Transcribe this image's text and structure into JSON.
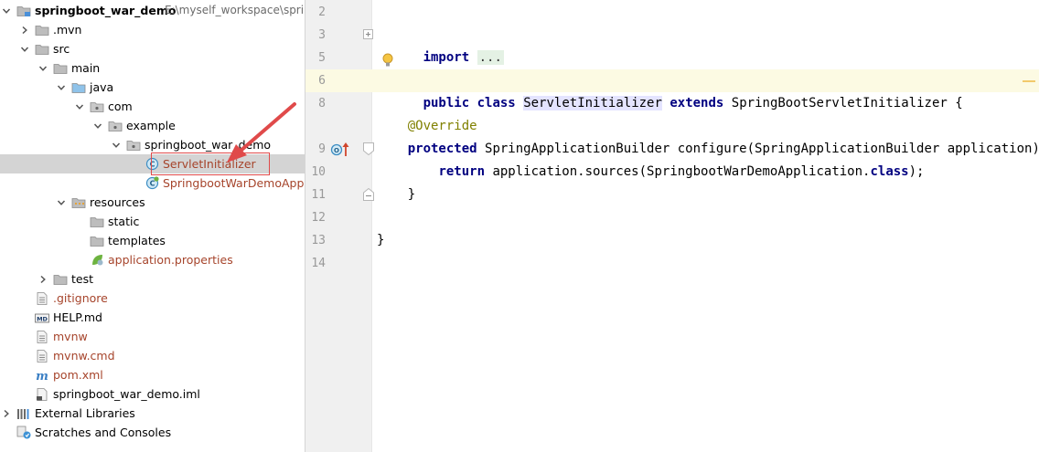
{
  "project_tree": {
    "rows": [
      {
        "id": "root",
        "label": "springboot_war_demo",
        "path": "E:\\myself_workspace\\sprin",
        "bold": true,
        "indent": 0,
        "arrow": "down",
        "icon": "module-folder-icon"
      },
      {
        "id": "mvn",
        "label": ".mvn",
        "indent": 1,
        "arrow": "right",
        "icon": "folder-icon"
      },
      {
        "id": "src",
        "label": "src",
        "indent": 1,
        "arrow": "down",
        "icon": "folder-icon"
      },
      {
        "id": "main",
        "label": "main",
        "indent": 2,
        "arrow": "down",
        "icon": "folder-icon"
      },
      {
        "id": "java",
        "label": "java",
        "indent": 3,
        "arrow": "down",
        "icon": "source-folder-icon"
      },
      {
        "id": "com",
        "label": "com",
        "indent": 4,
        "arrow": "down",
        "icon": "package-icon"
      },
      {
        "id": "example",
        "label": "example",
        "indent": 5,
        "arrow": "down",
        "icon": "package-icon"
      },
      {
        "id": "pkg",
        "label": "springboot_war_demo",
        "indent": 6,
        "arrow": "down",
        "icon": "package-icon"
      },
      {
        "id": "servlet",
        "label": "ServletInitializer",
        "indent": 7,
        "arrow": "none",
        "icon": "class-icon",
        "selected": true,
        "git": true
      },
      {
        "id": "app",
        "label": "SpringbootWarDemoApplication",
        "indent": 7,
        "arrow": "none",
        "icon": "spring-class-icon",
        "git": true
      },
      {
        "id": "resources",
        "label": "resources",
        "indent": 3,
        "arrow": "down",
        "icon": "resources-folder-icon"
      },
      {
        "id": "static",
        "label": "static",
        "indent": 4,
        "arrow": "none",
        "icon": "folder-icon"
      },
      {
        "id": "templates",
        "label": "templates",
        "indent": 4,
        "arrow": "none",
        "icon": "folder-icon"
      },
      {
        "id": "props",
        "label": "application.properties",
        "indent": 4,
        "arrow": "none",
        "icon": "spring-properties-icon",
        "git": true
      },
      {
        "id": "test",
        "label": "test",
        "indent": 2,
        "arrow": "right",
        "icon": "folder-icon"
      },
      {
        "id": "gitignore",
        "label": ".gitignore",
        "indent": 1,
        "arrow": "none",
        "icon": "text-file-icon",
        "git": true
      },
      {
        "id": "help",
        "label": "HELP.md",
        "indent": 1,
        "arrow": "none",
        "icon": "markdown-file-icon"
      },
      {
        "id": "mvnw",
        "label": "mvnw",
        "indent": 1,
        "arrow": "none",
        "icon": "text-file-icon",
        "git": true
      },
      {
        "id": "mvnwcmd",
        "label": "mvnw.cmd",
        "indent": 1,
        "arrow": "none",
        "icon": "text-file-icon",
        "git": true
      },
      {
        "id": "pom",
        "label": "pom.xml",
        "indent": 1,
        "arrow": "none",
        "icon": "maven-file-icon",
        "git": true
      },
      {
        "id": "iml",
        "label": "springboot_war_demo.iml",
        "indent": 1,
        "arrow": "none",
        "icon": "iml-file-icon"
      },
      {
        "id": "extlib",
        "label": "External Libraries",
        "indent": 0,
        "arrow": "right",
        "icon": "libraries-icon"
      },
      {
        "id": "scratch",
        "label": "Scratches and Consoles",
        "indent": 0,
        "arrow": "none",
        "icon": "scratches-icon"
      }
    ]
  },
  "editor": {
    "line_numbers": [
      "2",
      "3",
      "5",
      "6",
      "8",
      "9",
      "10",
      "11",
      "12",
      "13",
      "14"
    ],
    "current_line": "6",
    "code": {
      "import_kw": "import",
      "import_fold": "...",
      "public_kw": "public",
      "class_kw": "class",
      "class_name": "ServletInitializer",
      "extends_kw": "extends",
      "super_class": "SpringBootServletInitializer",
      "open_brace": "{",
      "override": "@Override",
      "protected_kw": "protected",
      "configure_sig": "SpringApplicationBuilder configure(SpringApplicationBuilder application) {",
      "return_kw": "return",
      "return_expr_a": "application.sources(SpringbootWarDemoApplication.",
      "class_literal": "class",
      "return_expr_b": ");",
      "close_method": "}",
      "close_class": "}"
    }
  },
  "colors": {
    "keyword": "#000080",
    "annotation": "#808000",
    "git_modified": "#a6442b",
    "selection": "#d4d4d4",
    "callout_red": "#e04a4a"
  }
}
